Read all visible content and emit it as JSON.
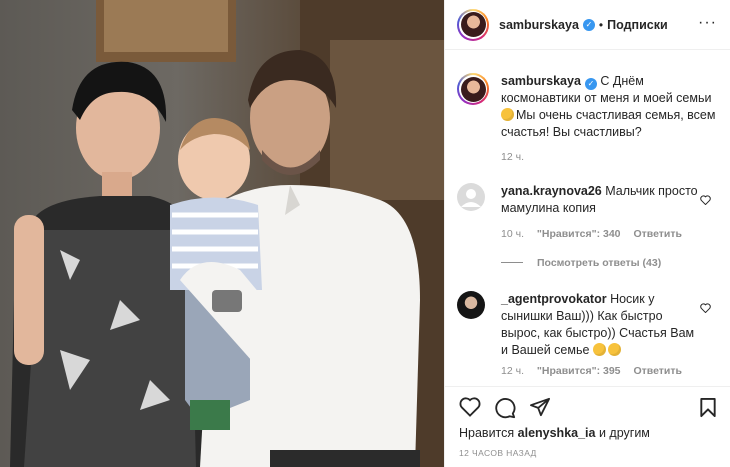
{
  "post": {
    "username": "samburskaya",
    "follow_label": "Подписки",
    "dot": "•"
  },
  "caption": {
    "username": "samburskaya",
    "text_1": " С Днём космонавтики от меня и моей семьи ",
    "text_2": "Мы очень счастливая семья, всем счастья! Вы счастливы?",
    "time": "12 ч."
  },
  "comments": [
    {
      "username": "yana.kraynova26",
      "text": " Мальчик просто мамулина копия",
      "time": "10 ч.",
      "likes": "\"Нравится\": 340",
      "reply": "Ответить"
    },
    {
      "username": "_agentprovokator",
      "text": " Носик у сынишки Ваш))) Как быстро вырос, как быстро)) Счастья Вам и Вашей семье ",
      "time": "12 ч.",
      "likes": "\"Нравится\": 395",
      "reply": "Ответить"
    }
  ],
  "view_replies": "Посмотреть ответы (43)",
  "likes_line": {
    "prefix": "Нравится ",
    "user": "alenyshka_ia",
    "suffix": " и другим"
  },
  "timestamp": "12 ЧАСОВ НАЗАД",
  "icons": [
    "more-icon",
    "verified-badge-icon",
    "heart-icon",
    "comment-icon",
    "share-icon",
    "bookmark-icon"
  ],
  "colors": {
    "verified": "#3897f0",
    "muted": "#8e8e8e",
    "text": "#262626"
  }
}
